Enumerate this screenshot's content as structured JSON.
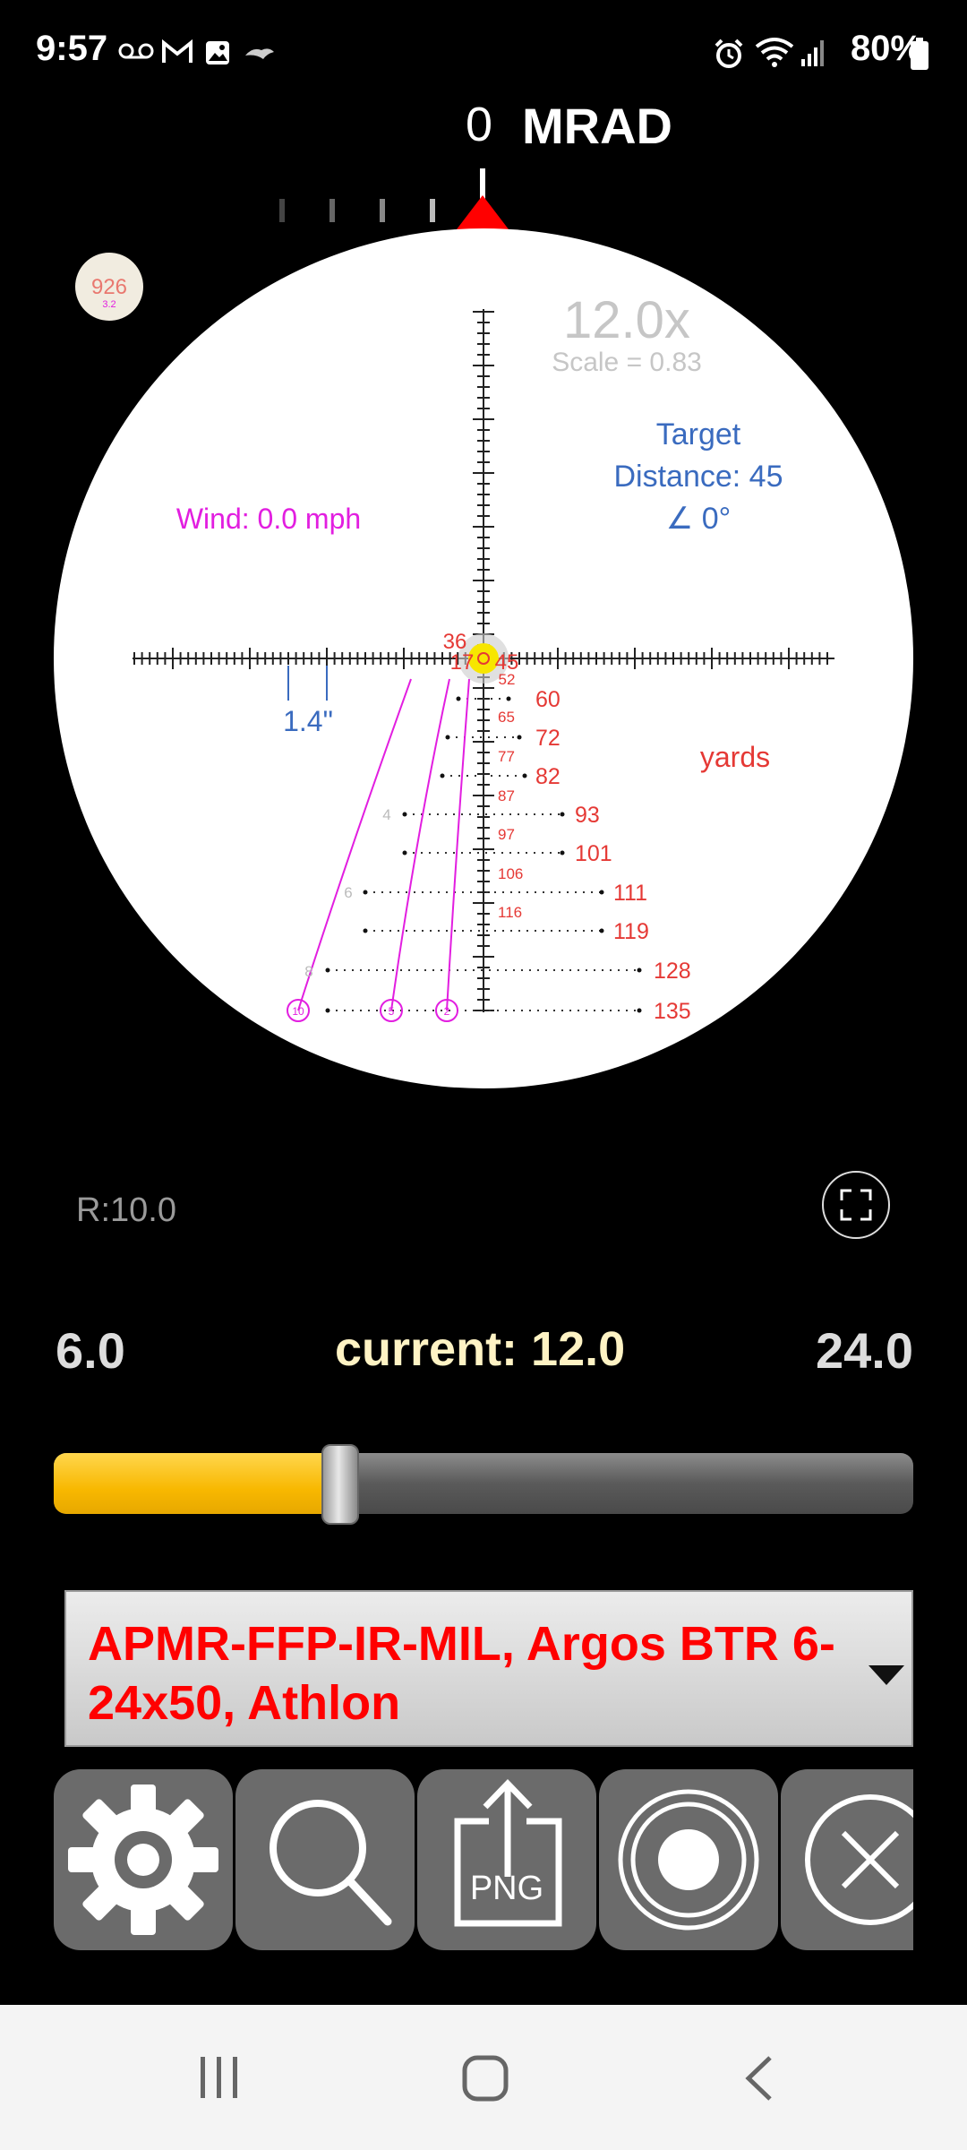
{
  "status_bar": {
    "time": "9:57",
    "battery": "80%"
  },
  "heading": {
    "value": "0",
    "unit": "MRAD"
  },
  "reticle": {
    "badge_value": "926",
    "badge_sub": "3.2",
    "magnification": "12.0x",
    "scale": "Scale = 0.83",
    "target_title": "Target",
    "target_distance": "Distance: 45",
    "target_angle": "∠ 0°",
    "wind": "Wind: 0.0 mph",
    "inch_value": "1.4\"",
    "units": "yards",
    "center_labels": [
      "36",
      "17",
      "45",
      "52"
    ],
    "small_distances": [
      "65",
      "77",
      "87",
      "97",
      "106",
      "116"
    ],
    "right_distances": [
      "60",
      "72",
      "82",
      "93",
      "101",
      "111",
      "119",
      "128",
      "135"
    ],
    "wind_marks": [
      "4",
      "6",
      "8"
    ],
    "circle_labels": [
      "10",
      "5",
      "2"
    ],
    "colors": {
      "red": "#e53935",
      "blue": "#3a6bbf",
      "magenta": "#e21ee0"
    }
  },
  "range_label": "R:10.0",
  "zoom": {
    "min": "6.0",
    "current": "current: 12.0",
    "max": "24.0",
    "position": 0.333
  },
  "scope_select": {
    "value": "APMR-FFP-IR-MIL, Argos BTR 6-24x50, Athlon"
  },
  "toolbar": {
    "png_label": "PNG"
  },
  "icons": [
    "gear-icon",
    "search-icon",
    "png-export-icon",
    "record-icon",
    "close-icon",
    "fullscreen-icon"
  ]
}
